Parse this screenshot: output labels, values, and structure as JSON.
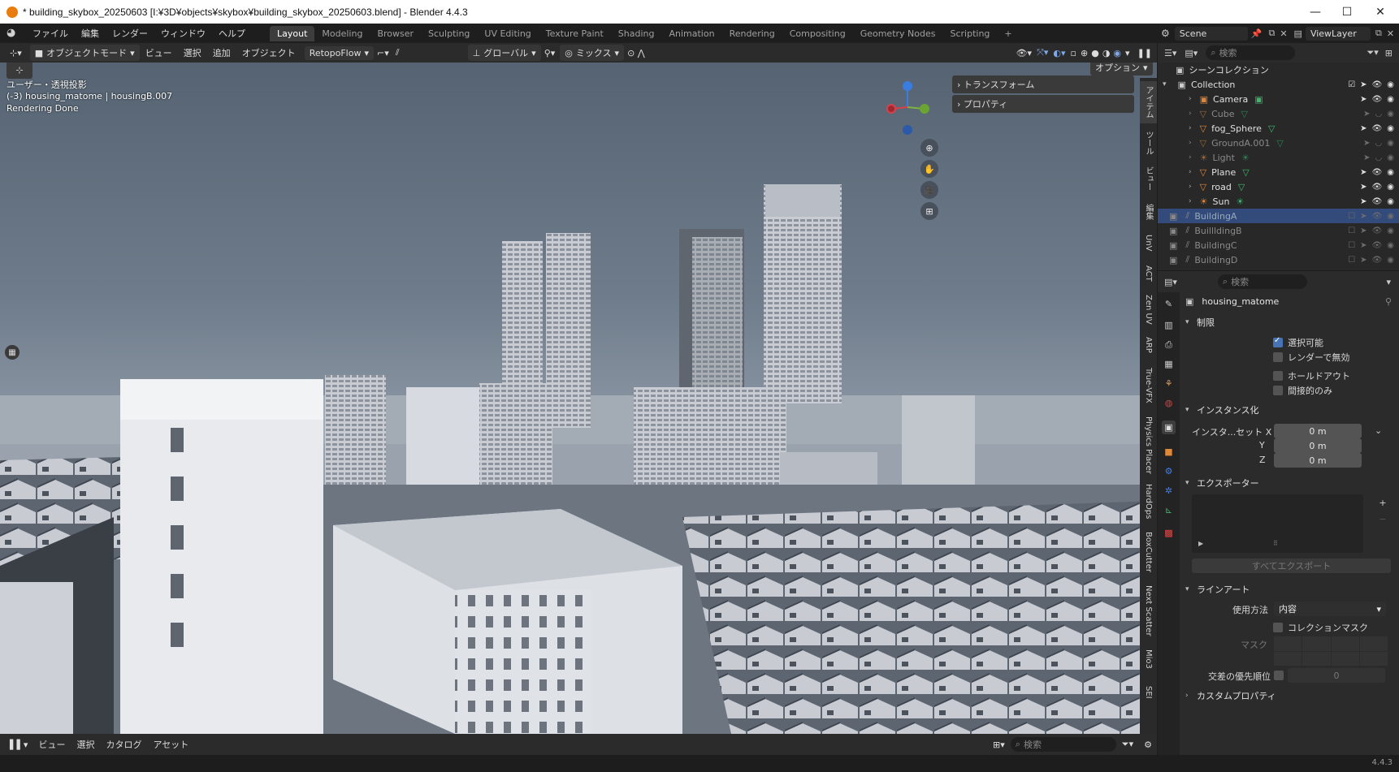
{
  "window": {
    "title": "* building_skybox_20250603 [I:¥3D¥objects¥skybox¥building_skybox_20250603.blend] - Blender 4.4.3",
    "minimize": "—",
    "maximize": "☐",
    "close": "✕"
  },
  "menu": {
    "items": [
      "ファイル",
      "編集",
      "レンダー",
      "ウィンドウ",
      "ヘルプ"
    ],
    "workspaces": [
      "Layout",
      "Modeling",
      "Browser",
      "Sculpting",
      "UV Editing",
      "Texture Paint",
      "Shading",
      "Animation",
      "Rendering",
      "Compositing",
      "Geometry Nodes",
      "Scripting"
    ],
    "active_workspace": "Layout",
    "add_workspace": "+",
    "scene": "Scene",
    "view_layer": "ViewLayer"
  },
  "viewport_header": {
    "mode": "オブジェクトモード",
    "view": "ビュー",
    "select": "選択",
    "add": "追加",
    "object": "オブジェクト",
    "addon": "RetopoFlow",
    "transform_orientation": "グローバル",
    "pivot": "ミックス",
    "options": "オプション"
  },
  "viewport": {
    "view_name": "ユーザー・透視投影",
    "object_info": "(-3) housing_matome | housingB.007",
    "render_status": "Rendering Done",
    "npanel": [
      "トランスフォーム",
      "プロパティ"
    ],
    "gizmo_axes": [
      "Z",
      "X",
      "Y"
    ]
  },
  "sidebar_tabs": [
    "アイテム",
    "ツール",
    "ビュー",
    "編集",
    "UnV",
    "ACT",
    "Zen UV",
    "ARP",
    "True-VFX",
    "Physics Placer",
    "HardOps",
    "BoxCutter",
    "Next Scatter",
    "Mio3",
    "SEI"
  ],
  "bottom_bar": {
    "view": "ビュー",
    "select": "選択",
    "catalog": "カタログ",
    "asset": "アセット",
    "search_placeholder": "検索"
  },
  "status_bar": {
    "version": "4.4.3"
  },
  "outliner": {
    "search_placeholder": "検索",
    "scene_collection": "シーンコレクション",
    "collection": "Collection",
    "items": [
      {
        "name": "Camera",
        "dim": false
      },
      {
        "name": "Cube",
        "dim": true
      },
      {
        "name": "fog_Sphere",
        "dim": false
      },
      {
        "name": "GroundA.001",
        "dim": true
      },
      {
        "name": "Light",
        "dim": true
      },
      {
        "name": "Plane",
        "dim": false
      },
      {
        "name": "road",
        "dim": false
      },
      {
        "name": "Sun",
        "dim": false
      }
    ],
    "collections": [
      "BuildingA",
      "BuillldingB",
      "BuildingC",
      "BuildingD"
    ]
  },
  "properties": {
    "search_placeholder": "検索",
    "object_name": "housing_matome",
    "restrictions": {
      "header": "制限",
      "selectable": "選択可能",
      "disable_render": "レンダーで無効",
      "holdout": "ホールドアウト",
      "indirect_only": "間接的のみ"
    },
    "instancing": {
      "header": "インスタンス化",
      "offset_label": "インスタ...セット X",
      "y_label": "Y",
      "z_label": "Z",
      "x": "0 m",
      "y": "0 m",
      "z": "0 m"
    },
    "exporter": {
      "header": "エクスポーター",
      "export_all": "すべてエクスポート"
    },
    "lineart": {
      "header": "ラインアート",
      "usage_label": "使用方法",
      "usage_value": "内容",
      "collection_mask": "コレクションマスク",
      "mask_label": "マスク",
      "intersection_label": "交差の優先順位",
      "intersection_value": "0"
    },
    "custom_props": "カスタムプロパティ"
  }
}
